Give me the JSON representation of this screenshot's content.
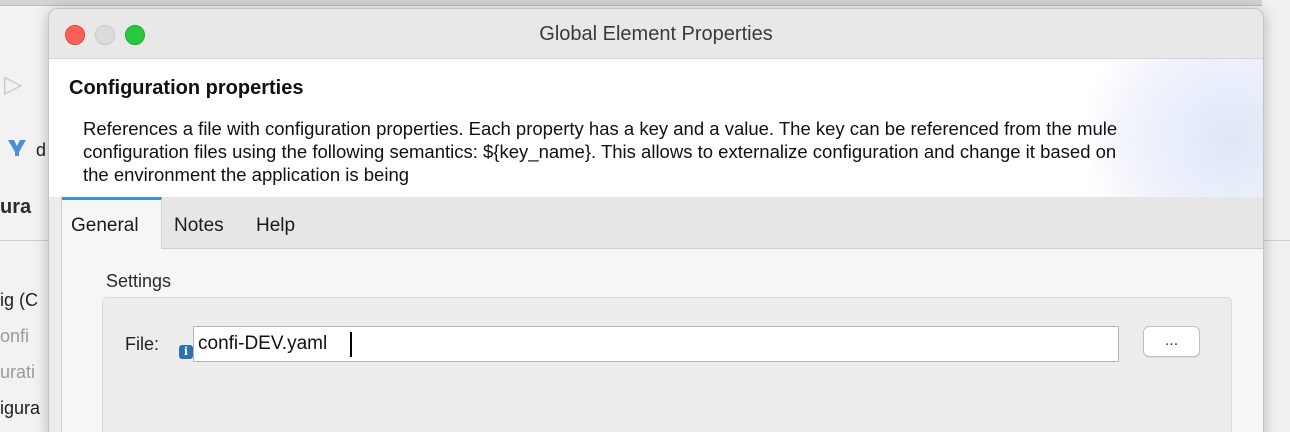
{
  "background": {
    "heading_fragment": "ura",
    "items": [
      {
        "text": "ig (C",
        "dim": false
      },
      {
        "text": "onfi",
        "dim": true
      },
      {
        "text": "urati",
        "dim": true
      },
      {
        "text": "igura",
        "dim": false
      }
    ],
    "side_text": "d",
    "icons": [
      "back-arrow-icon",
      "tool-icon",
      "mule-project-icon"
    ]
  },
  "dialog": {
    "title": "Global Element Properties",
    "traffic_lights": [
      "close",
      "minimize",
      "zoom"
    ],
    "header": {
      "title": "Configuration properties",
      "description": "References a file with configuration properties. Each property has a key and a value. The key can be referenced from the mule configuration files using the following semantics: ${key_name}. This allows to externalize configuration and change it based on the environment the application is being"
    },
    "tabs": [
      {
        "label": "General",
        "active": true
      },
      {
        "label": "Notes",
        "active": false
      },
      {
        "label": "Help",
        "active": false
      }
    ],
    "general": {
      "section_label": "Settings",
      "file_label": "File:",
      "file_value": "confi-DEV.yaml",
      "browse_label": "..."
    }
  },
  "colors": {
    "tab_accent": "#3d8ee0",
    "close": "#fe5f57",
    "zoom": "#28c840",
    "info_icon": "#2f6fb5"
  }
}
